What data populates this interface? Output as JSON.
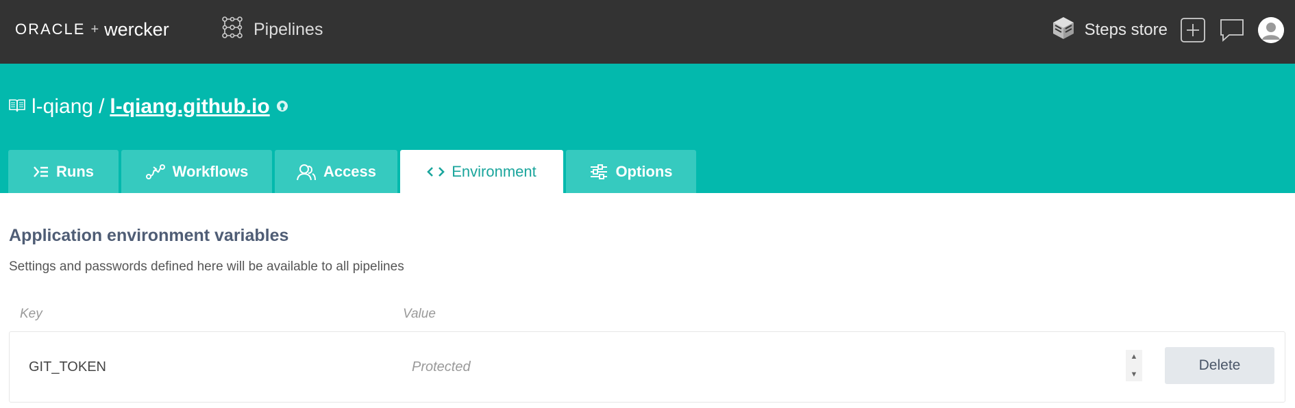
{
  "brand": {
    "oracle": "ORACLE",
    "plus": "+",
    "wercker": "wercker"
  },
  "nav": {
    "pipelines_label": "Pipelines",
    "steps_store_label": "Steps store"
  },
  "repo": {
    "owner": "l-qiang",
    "separator": "/",
    "name": "l-qiang.github.io"
  },
  "tabs": [
    {
      "label": "Runs",
      "icon": "runs-icon",
      "active": false
    },
    {
      "label": "Workflows",
      "icon": "workflows-icon",
      "active": false
    },
    {
      "label": "Access",
      "icon": "access-icon",
      "active": false
    },
    {
      "label": "Environment",
      "icon": "code-icon",
      "active": true
    },
    {
      "label": "Options",
      "icon": "options-icon",
      "active": false
    }
  ],
  "env": {
    "heading": "Application environment variables",
    "description": "Settings and passwords defined here will be available to all pipelines",
    "columns": {
      "key": "Key",
      "value": "Value"
    },
    "rows": [
      {
        "key": "GIT_TOKEN",
        "value": "Protected",
        "delete_label": "Delete"
      }
    ]
  },
  "colors": {
    "topbar": "#333333",
    "teal": "#03b9ad",
    "tab": "#36cabf",
    "active_tab_text": "#1aa59c"
  }
}
